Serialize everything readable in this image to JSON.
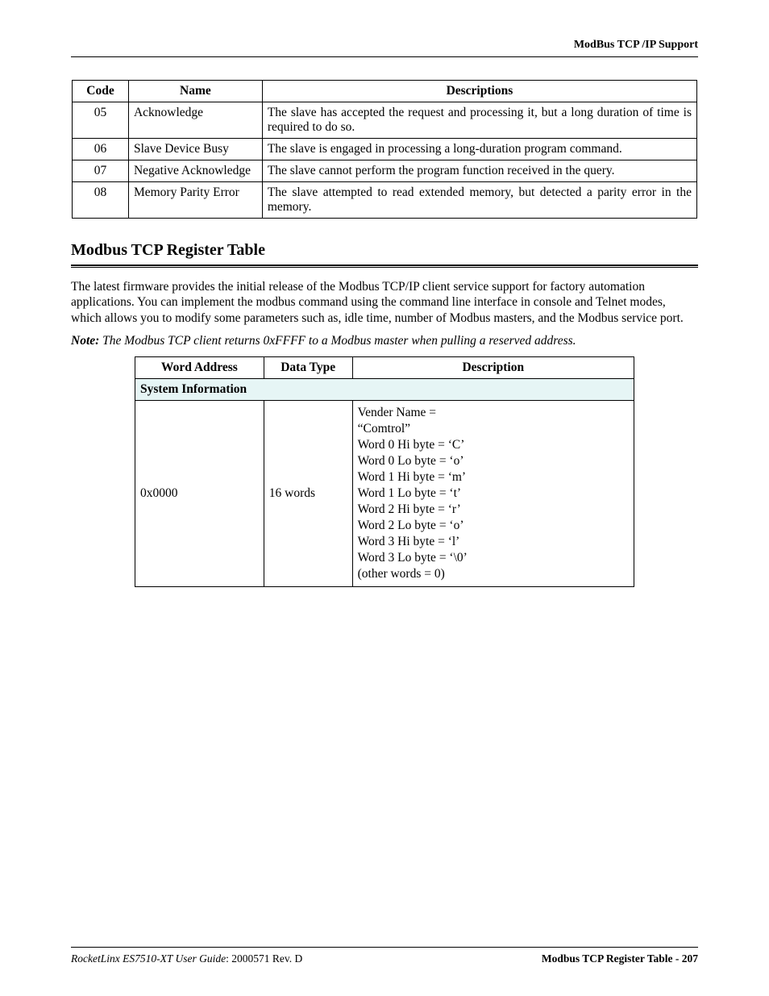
{
  "header": {
    "running_title": "ModBus TCP /IP Support"
  },
  "table1": {
    "headers": {
      "code": "Code",
      "name": "Name",
      "desc": "Descriptions"
    },
    "rows": [
      {
        "code": "05",
        "name": "Acknowledge",
        "desc": "The slave has accepted the request and processing it, but a long duration of time is required to do so."
      },
      {
        "code": "06",
        "name": "Slave Device Busy",
        "desc": "The slave is engaged in processing a long-duration program command."
      },
      {
        "code": "07",
        "name": "Negative Acknowledge",
        "desc": "The slave cannot perform the program function received in the query."
      },
      {
        "code": "08",
        "name": "Memory Parity Error",
        "desc": "The slave attempted to read extended memory, but detected a parity error in the memory."
      }
    ]
  },
  "section": {
    "title": "Modbus TCP Register Table",
    "body": "The latest firmware provides the initial release of the Modbus TCP/IP client service support for factory automation applications. You can implement the modbus command using the command line interface in console and Telnet modes, which allows you to modify some parameters such as, idle time, number of Modbus masters, and the Modbus service port.",
    "note_label": "Note:",
    "note_text": "The Modbus TCP client returns 0xFFFF to a Modbus master when pulling a reserved address."
  },
  "table2": {
    "headers": {
      "addr": "Word Address",
      "dtype": "Data Type",
      "desc": "Description"
    },
    "section_row": "System Information",
    "row": {
      "addr": "0x0000",
      "dtype": "16 words",
      "desc_lines": [
        "Vender Name =",
        "“Comtrol”",
        "Word 0 Hi byte = ‘C’",
        "Word 0 Lo byte = ‘o’",
        "Word 1 Hi byte = ‘m’",
        "Word 1 Lo byte = ‘t’",
        "Word 2 Hi byte = ‘r’",
        "Word 2 Lo byte = ‘o’",
        "Word 3 Hi byte = ‘l’",
        "Word 3 Lo byte = ‘\\0’",
        "(other words = 0)"
      ]
    }
  },
  "footer": {
    "product": "RocketLinx ES7510-XT  User Guide",
    "rev": ": 2000571 Rev. D",
    "right": "Modbus TCP Register Table - 207"
  }
}
